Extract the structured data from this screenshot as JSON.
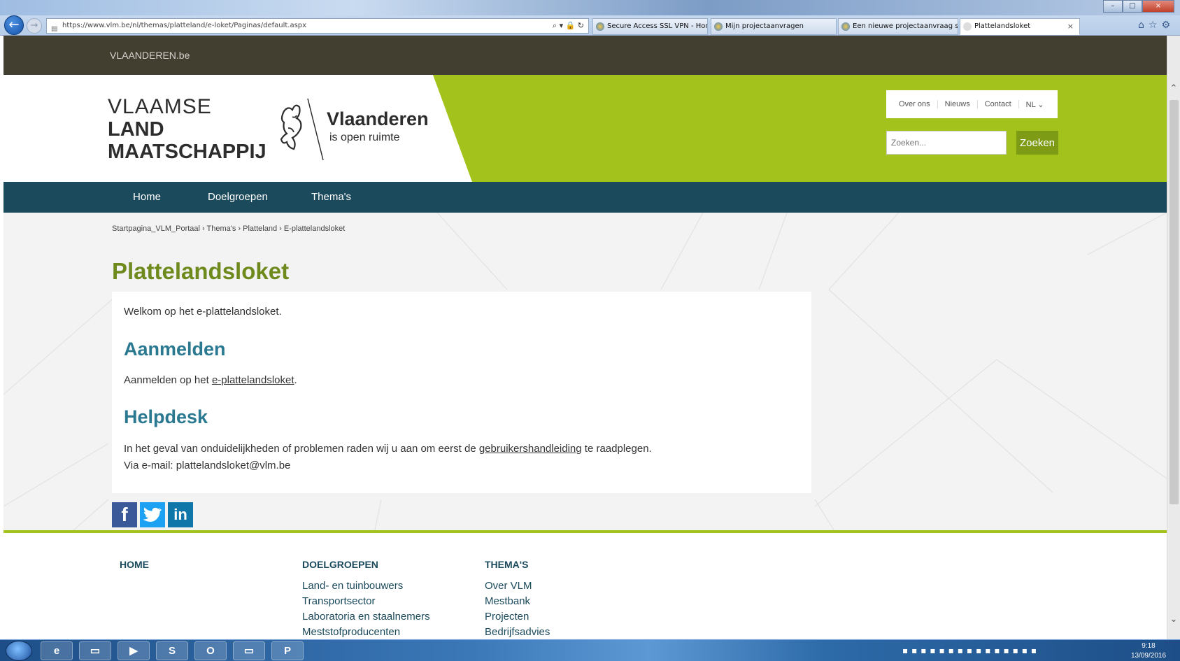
{
  "browser": {
    "window_title": "",
    "address": "https://www.vlm.be/nl/themas/platteland/e-loket/Paginas/default.aspx",
    "tabs": [
      {
        "label": "Secure Access SSL VPN - Home"
      },
      {
        "label": "Mijn projectaanvragen"
      },
      {
        "label": "Een nieuwe projectaanvraag st..."
      },
      {
        "label": "Plattelandsloket"
      }
    ],
    "tab_close": "×",
    "min": "–",
    "max": "□",
    "close": "×"
  },
  "site": {
    "topbar_link": "VLAANDEREN.be",
    "logo": {
      "line1": "VLAAMSE",
      "line2": "LAND",
      "line3": "MAATSCHAPPIJ"
    },
    "vlaanderen_title": "Vlaanderen",
    "vlaanderen_sub": "is open ruimte",
    "utility_links": [
      "Over ons",
      "Nieuws",
      "Contact",
      "NL ⌄"
    ],
    "search_placeholder": "Zoeken...",
    "search_button": "Zoeken",
    "nav": [
      "Home",
      "Doelgroepen",
      "Thema's"
    ]
  },
  "breadcrumb": "Startpagina_VLM_Portaal › Thema's › Platteland › E-plattelandsloket",
  "page_title": "Plattelandsloket",
  "content": {
    "welcome": "Welkom op het e-plattelandsloket.",
    "aanmelden_heading": "Aanmelden",
    "aanmelden_prefix": "Aanmelden op het ",
    "aanmelden_link": "e-plattelandsloket",
    "aanmelden_suffix": ".",
    "helpdesk_heading": "Helpdesk",
    "help_prefix": "In het geval van onduidelijkheden of problemen raden wij u aan om eerst de ",
    "help_link": "gebruikershandleiding",
    "help_suffix": " te raadplegen.",
    "help_email": "Via e-mail: plattelandsloket@vlm.be"
  },
  "social": {
    "facebook": "f",
    "twitter": "",
    "linkedin": "in"
  },
  "footer": {
    "col1_heading": "HOME",
    "col2_heading": "DOELGROEPEN",
    "col2_links": [
      "Land- en tuinbouwers",
      "Transportsector",
      "Laboratoria en staalnemers",
      "Meststofproducenten"
    ],
    "col3_heading": "THEMA'S",
    "col3_links": [
      "Over VLM",
      "Mestbank",
      "Projecten",
      "Bedrijfsadvies"
    ]
  },
  "taskbar": {
    "time": "9:18",
    "date": "13/09/2016",
    "apps": [
      "e",
      "▭",
      "▶",
      "S",
      "O",
      "▭",
      "P"
    ]
  },
  "colors": {
    "accent_green": "#a3c31c",
    "title_green": "#6f8a1c",
    "nav_blue": "#1b4a5c",
    "heading_blue": "#2a7990",
    "topbar": "#423f31"
  }
}
